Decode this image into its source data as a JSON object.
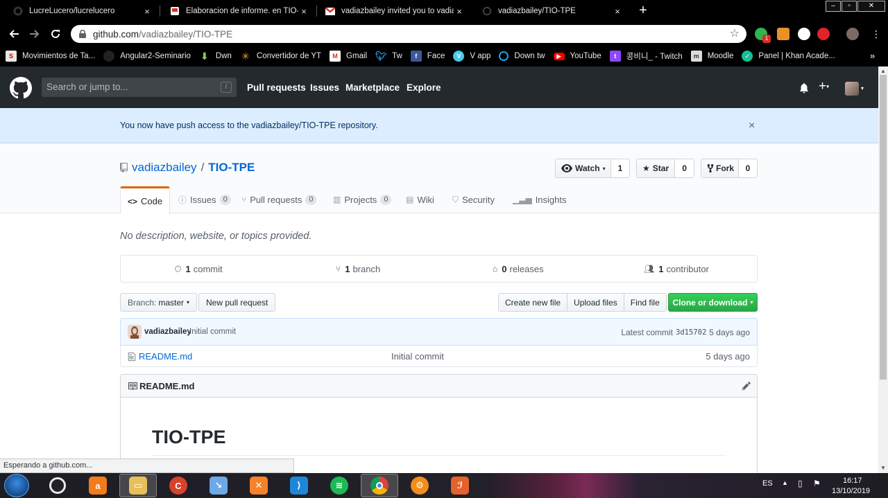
{
  "browser": {
    "tabs": [
      {
        "title": "LucreLucero/lucrelucero",
        "close": "×"
      },
      {
        "title": "Elaboracion de informe. en TIO-T",
        "close": "×"
      },
      {
        "title": "vadiazbailey invited you to vadia",
        "close": "×"
      },
      {
        "title": "vadiazbailey/TIO-TPE",
        "close": "×"
      }
    ],
    "new_tab": "+",
    "url_host": "github.com",
    "url_path": "/vadiazbailey/TIO-TPE",
    "bookmarks": [
      {
        "label": "Movimientos de Ta...",
        "icon": "bank-icon"
      },
      {
        "label": "Angular2-Seminario",
        "icon": "github-icon"
      },
      {
        "label": "Dwn",
        "icon": "download-icon"
      },
      {
        "label": "Convertidor de YT",
        "icon": "convert-icon"
      },
      {
        "label": "Gmail",
        "icon": "gmail-icon"
      },
      {
        "label": "Tw",
        "icon": "twitter-icon"
      },
      {
        "label": "Face",
        "icon": "facebook-icon"
      },
      {
        "label": "V app",
        "icon": "vapp-icon"
      },
      {
        "label": "Down tw",
        "icon": "download-twitter-icon"
      },
      {
        "label": "YouTube",
        "icon": "youtube-icon"
      },
      {
        "label": "콩비니_ - Twitch",
        "icon": "twitch-icon"
      },
      {
        "label": "Moodle",
        "icon": "moodle-icon"
      },
      {
        "label": "Panel | Khan Acade...",
        "icon": "khan-icon"
      }
    ],
    "bookmarks_overflow": "»",
    "extension_badge": "1"
  },
  "github": {
    "search_placeholder": "Search or jump to...",
    "search_key": "/",
    "nav": [
      "Pull requests",
      "Issues",
      "Marketplace",
      "Explore"
    ],
    "flash": "You now have push access to the vadiazbailey/TIO-TPE repository.",
    "flash_close": "×",
    "repo_owner": "vadiazbailey",
    "repo_sep": "/",
    "repo_name": "TIO-TPE",
    "watch": {
      "label": "Watch",
      "count": "1"
    },
    "star": {
      "label": "Star",
      "count": "0"
    },
    "fork": {
      "label": "Fork",
      "count": "0"
    },
    "tabs": {
      "code": "Code",
      "issues": {
        "label": "Issues",
        "count": "0"
      },
      "pulls": {
        "label": "Pull requests",
        "count": "0"
      },
      "projects": {
        "label": "Projects",
        "count": "0"
      },
      "wiki": "Wiki",
      "security": "Security",
      "insights": "Insights"
    },
    "description": "No description, website, or topics provided.",
    "summary": {
      "commits": {
        "num": "1",
        "label": "commit"
      },
      "branches": {
        "num": "1",
        "label": "branch"
      },
      "releases": {
        "num": "0",
        "label": "releases"
      },
      "contributors": {
        "num": "1",
        "label": "contributor"
      }
    },
    "branch_label": "Branch:",
    "branch_name": "master",
    "new_pr": "New pull request",
    "create_file": "Create new file",
    "upload_files": "Upload files",
    "find_file": "Find file",
    "clone": "Clone or download",
    "commit": {
      "author": "vadiazbailey",
      "message": "Initial commit",
      "latest_label": "Latest commit",
      "sha": "3d15702",
      "age": "5 days ago"
    },
    "files": [
      {
        "name": "README.md",
        "message": "Initial commit",
        "age": "5 days ago"
      }
    ],
    "readme": {
      "label": "README.md",
      "heading": "TIO-TPE"
    }
  },
  "status_bubble": "Esperando a github.com...",
  "taskbar": {
    "lang": "ES",
    "time": "16:17",
    "date": "13/10/2019"
  }
}
